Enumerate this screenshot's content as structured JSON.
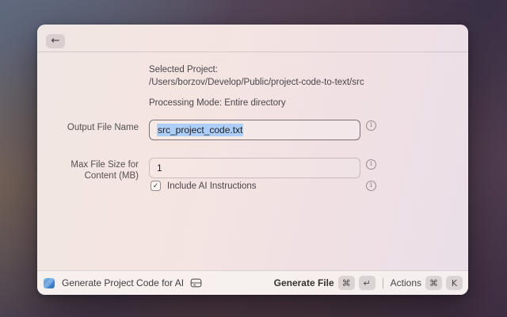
{
  "header": {
    "back_icon": "←"
  },
  "summary": {
    "selected_project": "Selected Project: /Users/borzov/Develop/Public/project-code-to-text/src",
    "processing_mode": "Processing Mode: Entire directory"
  },
  "form": {
    "output_file_name": {
      "label": "Output File Name",
      "value": "src_project_code.txt"
    },
    "max_file_size": {
      "label": "Max File Size for Content (MB)",
      "value": "1"
    },
    "include_ai": {
      "label": "Include AI Instructions",
      "checked": true,
      "check_glyph": "✓"
    }
  },
  "icons": {
    "info": "i"
  },
  "footer": {
    "command_title": "Generate Project Code for AI",
    "generate_file": {
      "label": "Generate File",
      "key_cmd": "⌘",
      "key_enter": "↵"
    },
    "actions": {
      "label": "Actions",
      "key_cmd": "⌘",
      "key_k": "K"
    }
  },
  "colors": {
    "selection_blue": "#accef7",
    "extension_icon_blue": "#4a8fd2",
    "window_tint_pink": "#f3e3e2",
    "desktop_plum": "#554454"
  }
}
